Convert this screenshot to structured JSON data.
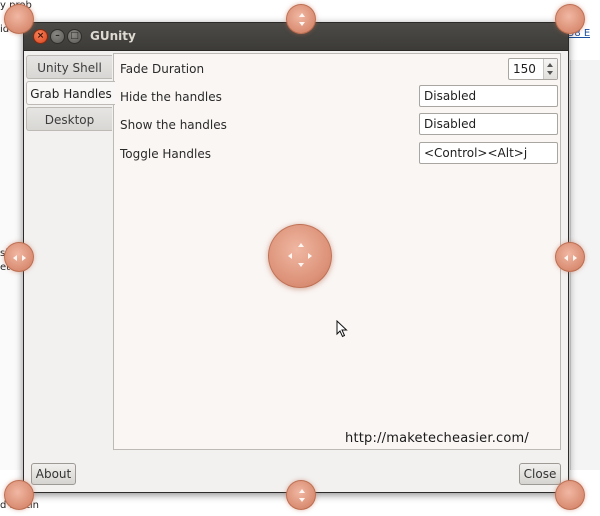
{
  "background": {
    "fragments": [
      {
        "text": "y prob",
        "link": false
      },
      {
        "text": "idel",
        "link": false
      },
      {
        "text": "58 E",
        "link": true
      },
      {
        "text": "siz",
        "link": false
      },
      {
        "text": "etecl",
        "link": false
      },
      {
        "text": "d Settin",
        "link": false
      }
    ]
  },
  "window": {
    "title": "GUnity",
    "controls": {
      "close": "×",
      "minimize": "–",
      "maximize": "□"
    }
  },
  "tabs": [
    {
      "label": "Unity Shell",
      "active": false
    },
    {
      "label": "Grab Handles",
      "active": true
    },
    {
      "label": "Desktop",
      "active": false
    }
  ],
  "settings": {
    "fade_duration": {
      "label": "Fade Duration",
      "value": "150"
    },
    "hide_handles": {
      "label": "Hide the handles",
      "value": "Disabled"
    },
    "show_handles": {
      "label": "Show the handles",
      "value": "Disabled"
    },
    "toggle_handles": {
      "label": "Toggle Handles",
      "value": "<Control><Alt>j"
    }
  },
  "watermark": "http://maketecheasier.com/",
  "buttons": {
    "about": "About",
    "close": "Close"
  },
  "colors": {
    "titlebar": "#3c3b37",
    "close_button": "#e0502a",
    "handle": "#dc9278",
    "panel": "#faf6f4"
  },
  "icons": {
    "handle": "resize-handle-icon",
    "cursor": "mouse-cursor-icon"
  }
}
